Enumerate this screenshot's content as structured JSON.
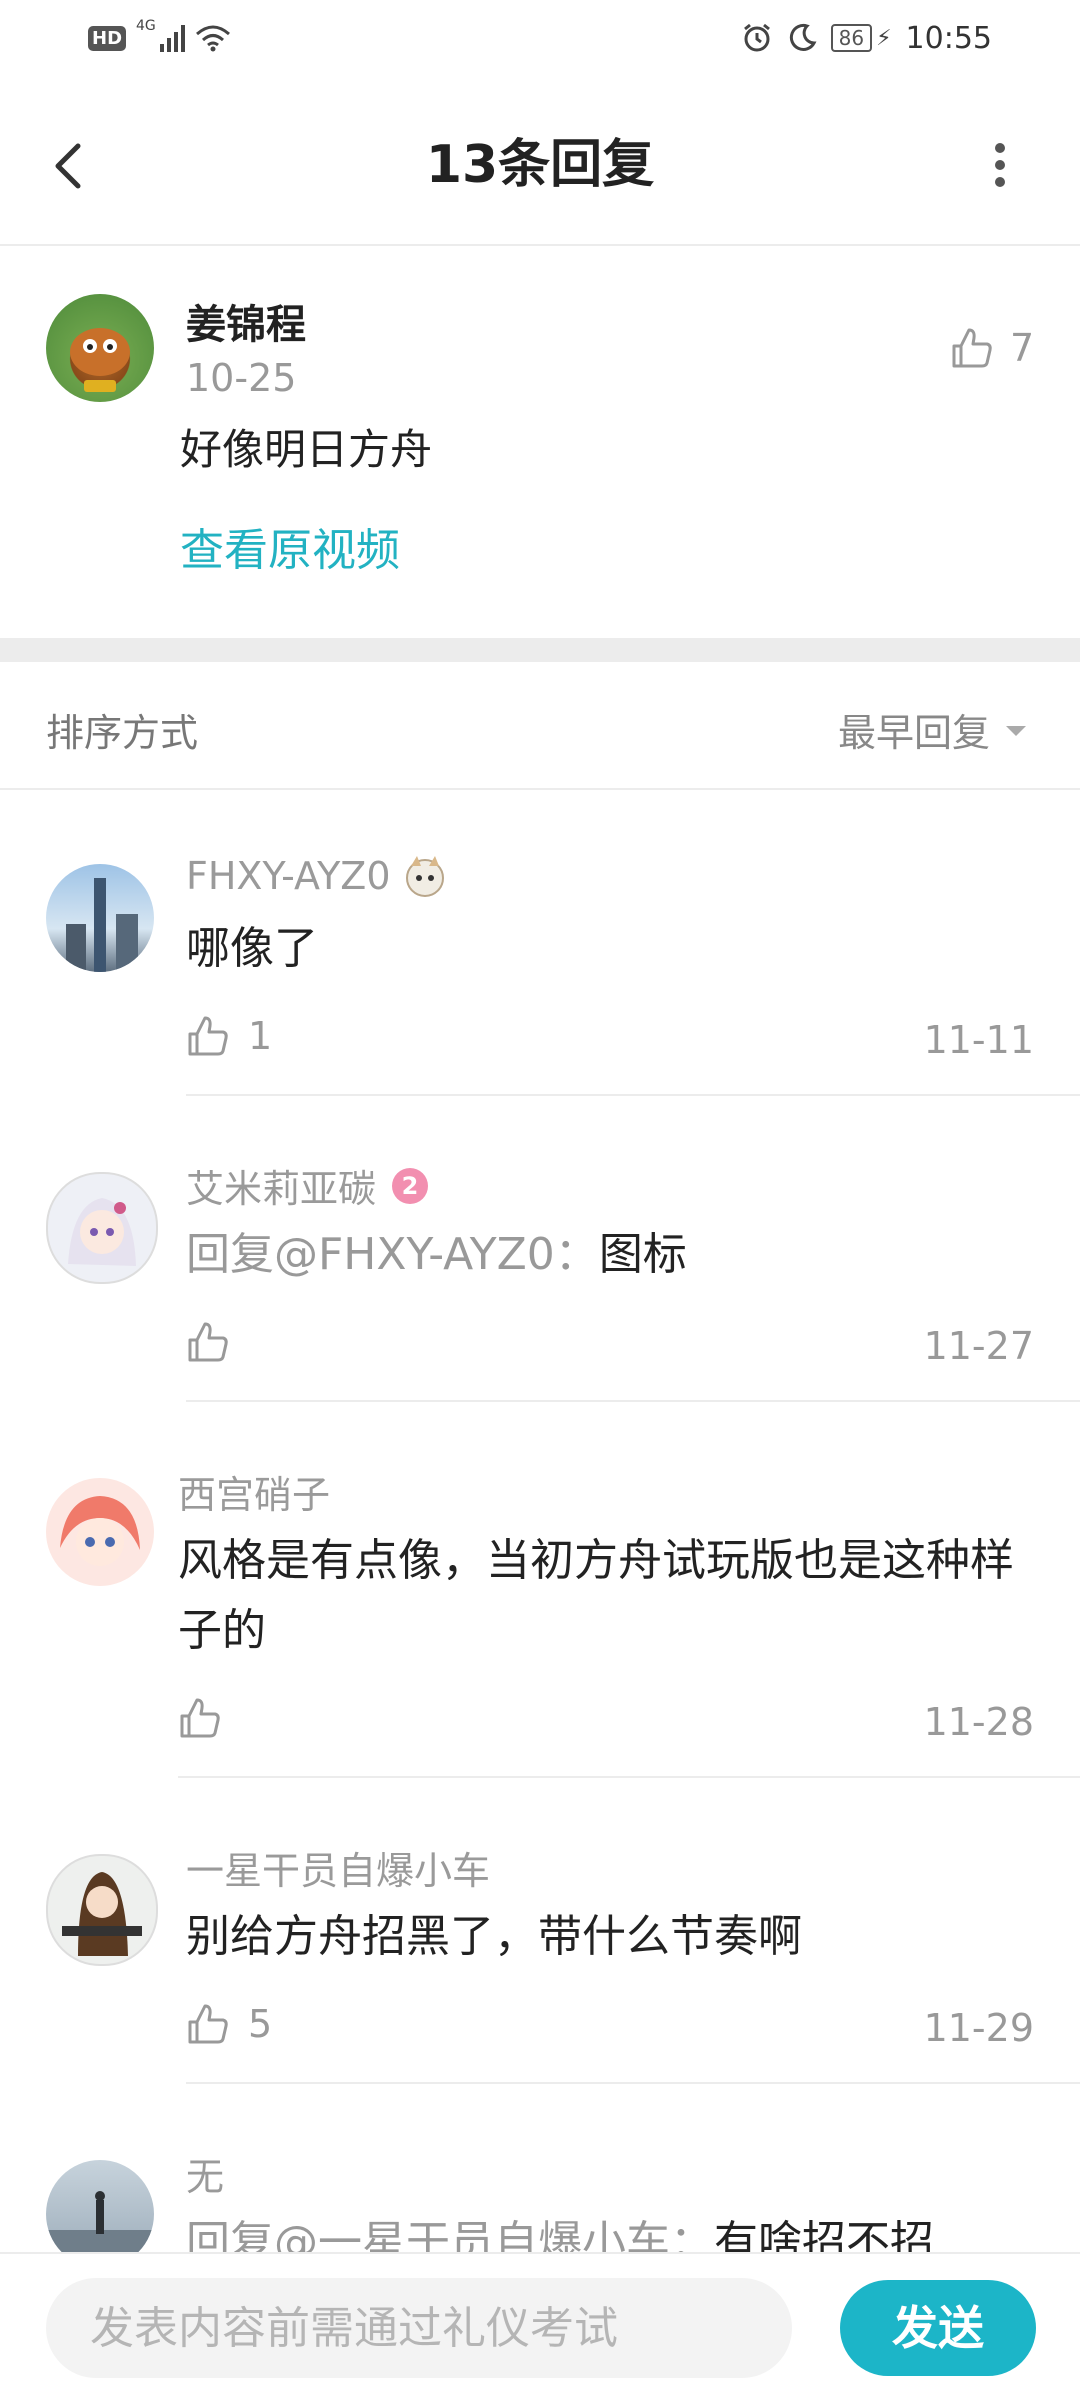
{
  "status_bar": {
    "left_badge": "HD",
    "network": "4G",
    "battery": "86",
    "time": "10:55",
    "icons": [
      "hd-icon",
      "signal-icon",
      "wifi-icon",
      "alarm-icon",
      "moon-icon",
      "battery-icon",
      "charging-icon"
    ]
  },
  "header": {
    "title": "13条回复",
    "back_icon": "back-arrow-icon",
    "more_icon": "more-vertical-icon"
  },
  "main_comment": {
    "author": "姜锦程",
    "date": "10-25",
    "text": "好像明日方舟",
    "likes": "7",
    "link_label": "查看原视频"
  },
  "sort": {
    "label": "排序方式",
    "value": "最早回复"
  },
  "replies": [
    {
      "author": "FHXY-AYZ0",
      "text": "哪像了",
      "mention": "",
      "likes": "1",
      "date": "11-11",
      "badge": "avatar-sticker-icon"
    },
    {
      "author": "艾米莉亚碳",
      "mention": "回复@FHXY-AYZ0：",
      "text": "图标",
      "likes": "",
      "date": "11-27",
      "badge": "level-2-badge-icon"
    },
    {
      "author": "西宫硝子",
      "text": "风格是有点像，当初方舟试玩版也是这种样子的",
      "mention": "",
      "likes": "",
      "date": "11-28"
    },
    {
      "author": "一星干员自爆小车",
      "text": "别给方舟招黑了，带什么节奏啊",
      "mention": "",
      "likes": "5",
      "date": "11-29"
    },
    {
      "author": "无",
      "mention": "回复@一星干员自爆小车：",
      "text": "有啥招不招",
      "likes": "",
      "date": ""
    }
  ],
  "composer": {
    "placeholder": "发表内容前需通过礼仪考试",
    "send_label": "发送"
  },
  "colors": {
    "accent": "#1cb5c8",
    "link": "#22b2c2",
    "divider": "#ececec"
  }
}
